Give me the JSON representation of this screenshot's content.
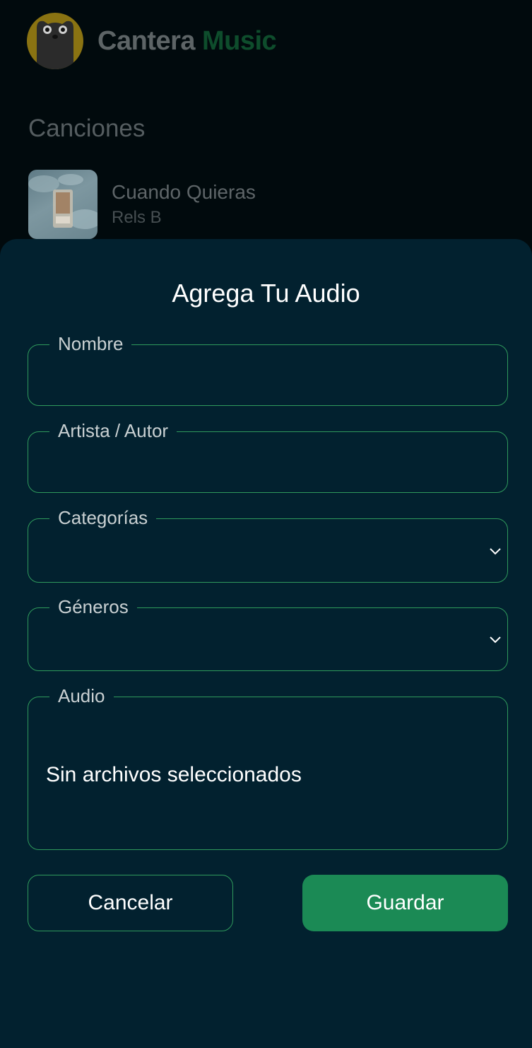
{
  "app": {
    "brand_part1": "Cantera",
    "brand_part2": "Music",
    "logo_icon": "bear-logo-icon"
  },
  "songs": {
    "section_title": "Canciones",
    "items": [
      {
        "title": "Cuando Quieras",
        "artist": "Rels B",
        "artwork_icon": "album-art-icon"
      }
    ]
  },
  "sheet": {
    "title": "Agrega Tu Audio",
    "fields": {
      "name": {
        "label": "Nombre",
        "value": ""
      },
      "artist": {
        "label": "Artista / Autor",
        "value": ""
      },
      "categories": {
        "label": "Categorías",
        "value": "",
        "icon": "chevron-down-icon"
      },
      "genres": {
        "label": "Géneros",
        "value": "",
        "icon": "chevron-down-icon"
      },
      "audio": {
        "label": "Audio",
        "value": "Sin archivos seleccionados"
      }
    },
    "buttons": {
      "cancel": "Cancelar",
      "save": "Guardar"
    }
  },
  "colors": {
    "accent_green": "#1b8a55",
    "border_green": "#2f9a5c",
    "sheet_bg": "#02212f",
    "page_bg": "#010a0d"
  }
}
